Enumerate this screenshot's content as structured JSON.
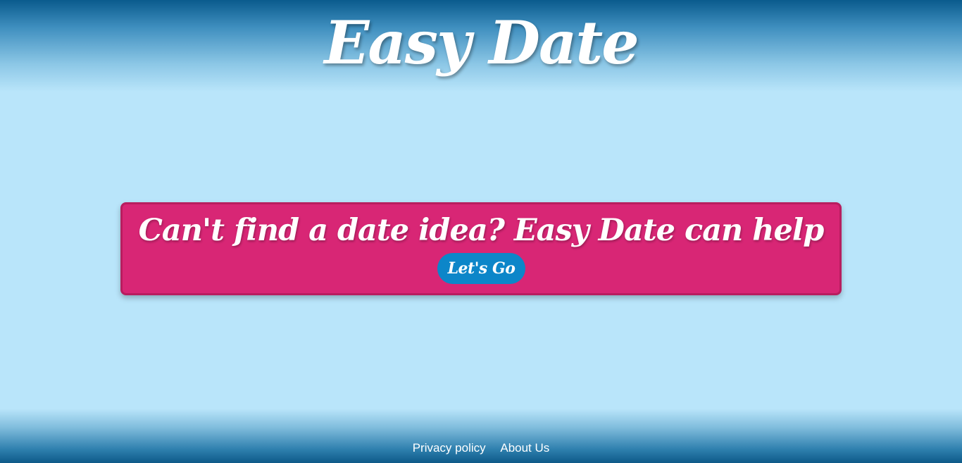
{
  "header": {
    "title": "Easy Date"
  },
  "hero": {
    "heading": "Can't find a date idea? Easy Date can help",
    "cta_label": "Let's Go"
  },
  "footer": {
    "links": [
      {
        "label": "Privacy policy"
      },
      {
        "label": "About Us"
      }
    ]
  },
  "colors": {
    "background": "#b9e5fa",
    "header_gradient_top": "#0a5b8d",
    "card": "#d82675",
    "card_border": "#b81d5f",
    "button": "#0c86c9",
    "text": "#ffffff"
  }
}
